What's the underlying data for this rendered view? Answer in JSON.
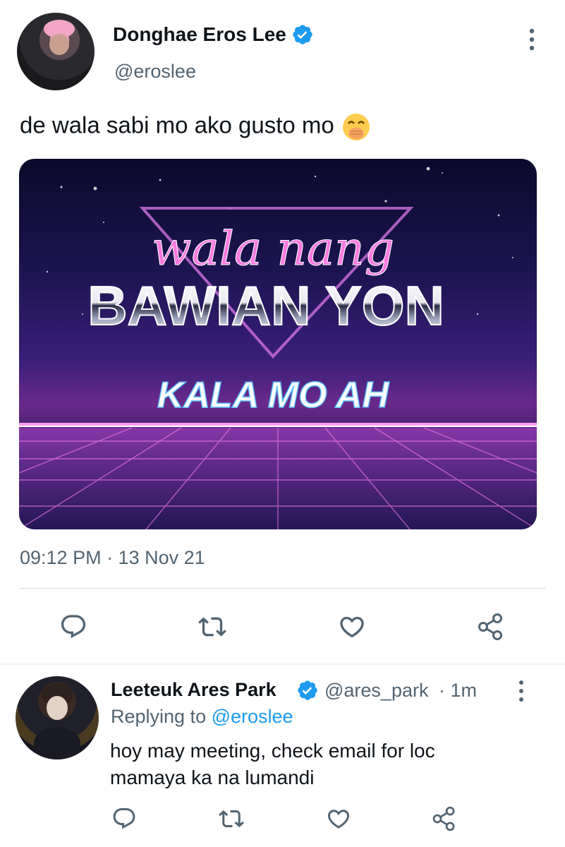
{
  "tweet": {
    "author_name": "Donghae Eros Lee",
    "author_handle": "@eroslee",
    "text": "de wala sabi mo ako gusto mo",
    "emoji": "face-with-hand-over-mouth",
    "media": {
      "line1": "wala nang",
      "line2": "BAWIAN YON",
      "line3": "KALA MO AH"
    },
    "timestamp": "09:12 PM · 13 Nov 21",
    "actions": [
      "reply",
      "retweet",
      "like",
      "share"
    ]
  },
  "reply": {
    "author_name": "Leeteuk Ares Park",
    "author_handle": "@ares_park",
    "time": "· 1m",
    "replying_to_label": "Replying to",
    "replying_to_handle": "@eroslee",
    "text_line1": "hoy may meeting, check email for loc",
    "text_line2": "mamaya ka na lumandi"
  },
  "colors": {
    "verified": "#1d9bf0",
    "text_secondary": "#536471",
    "link": "#1d9bf0",
    "icon": "#536471"
  }
}
